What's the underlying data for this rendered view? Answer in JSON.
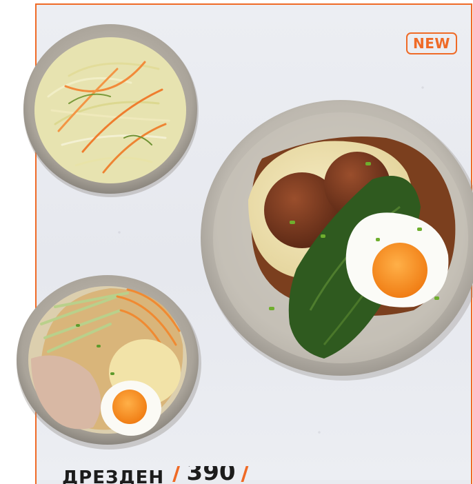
{
  "badge": {
    "label": "NEW"
  },
  "caption": {
    "name": "ДРЕЗДЕН",
    "price_open_slash": "/",
    "price": "390",
    "price_close_slash": "/"
  },
  "colors": {
    "accent": "#ef6a26",
    "background": "#e9ebf0",
    "text": "#1c1c1c"
  }
}
